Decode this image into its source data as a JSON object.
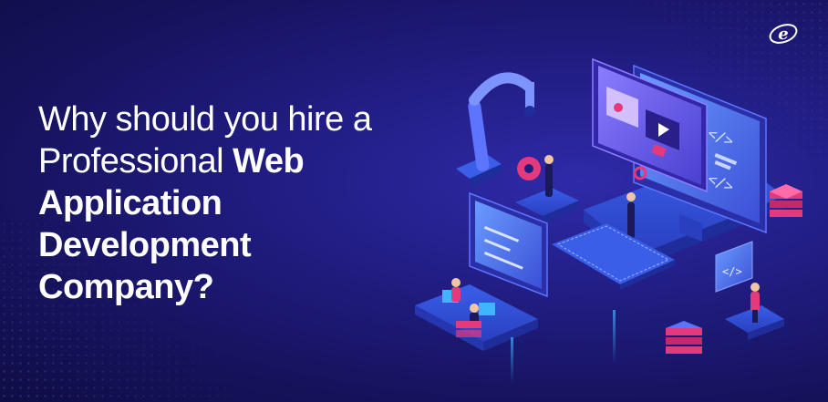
{
  "headline": {
    "line1": "Why should you hire a",
    "line2_light": "Professional ",
    "line2_bold": "Web",
    "line3": "Application",
    "line4": "Development",
    "line5": "Company?"
  },
  "logo": {
    "icon": "e-logo-icon",
    "letter": "e"
  },
  "illustration": {
    "icon": "isometric-web-development-illustration"
  },
  "colors": {
    "background": "#201c80",
    "text": "#ffffff",
    "accent_blue": "#3f6cf0",
    "accent_cyan": "#3fb5ff",
    "accent_pink": "#e23a7a"
  }
}
